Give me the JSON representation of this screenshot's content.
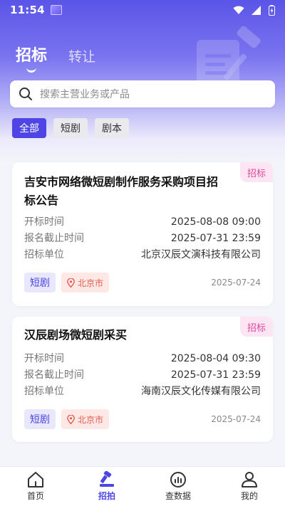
{
  "status": {
    "time": "11:54"
  },
  "header": {
    "tabs": [
      {
        "label": "招标",
        "active": true
      },
      {
        "label": "转让",
        "active": false
      }
    ]
  },
  "search": {
    "placeholder": "搜索主营业务或产品"
  },
  "filters": [
    {
      "label": "全部",
      "active": true
    },
    {
      "label": "短剧",
      "active": false
    },
    {
      "label": "剧本",
      "active": false
    }
  ],
  "cards": [
    {
      "tag": "招标",
      "title_line1": "吉安市网络微短剧制作服务采购项目招",
      "title_line2": "标公告",
      "rows": [
        {
          "key": "开标时间",
          "value": "2025-08-08 09:00"
        },
        {
          "key": "报名截止时间",
          "value": "2025-07-31 23:59"
        },
        {
          "key": "招标单位",
          "value": "北京汉辰文演科技有限公司"
        }
      ],
      "type_badge": "短剧",
      "location": "北京市",
      "date": "2025-07-24"
    },
    {
      "tag": "招标",
      "title_line1": "汉辰剧场微短剧采买",
      "rows": [
        {
          "key": "开标时间",
          "value": "2025-08-04 09:30"
        },
        {
          "key": "报名截止时间",
          "value": "2025-07-31 23:59"
        },
        {
          "key": "招标单位",
          "value": "海南汉辰文化传媒有限公司"
        }
      ],
      "type_badge": "短剧",
      "location": "北京市",
      "date": "2025-07-24"
    }
  ],
  "bottom_nav": [
    {
      "label": "首页",
      "icon": "home-icon",
      "active": false
    },
    {
      "label": "招拍",
      "icon": "gavel-icon",
      "active": true
    },
    {
      "label": "查数据",
      "icon": "data-icon",
      "active": false
    },
    {
      "label": "我的",
      "icon": "user-icon",
      "active": false
    }
  ],
  "colors": {
    "accent": "#4e45e4",
    "tag_pink": "#e0479a",
    "location_red": "#e45d50"
  }
}
